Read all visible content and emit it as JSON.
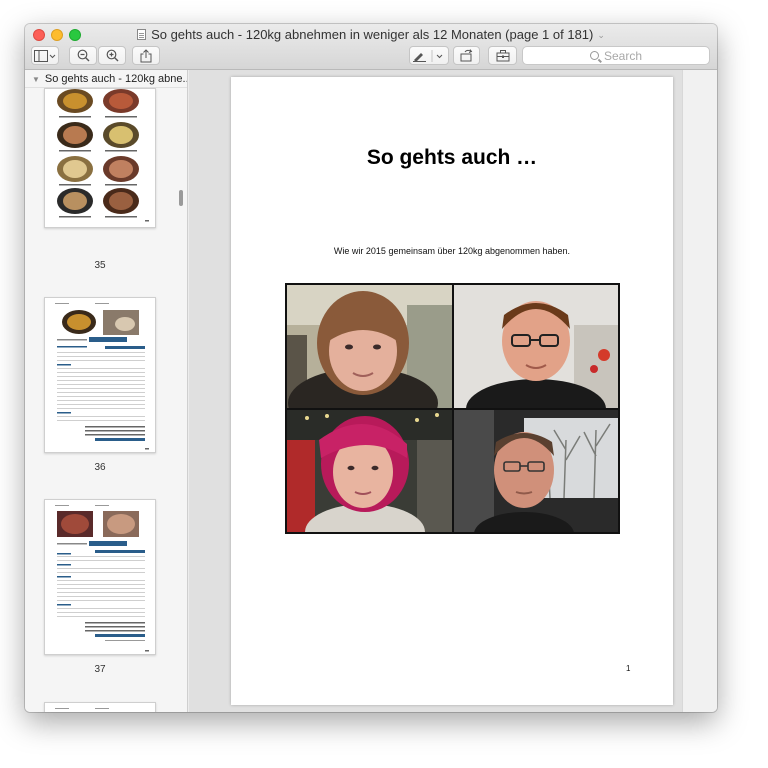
{
  "window": {
    "title": "So gehts auch - 120kg abnehmen in weniger als 12 Monaten (page 1 of 181)"
  },
  "toolbar": {
    "search_placeholder": "Search"
  },
  "sidebar": {
    "document_label": "So gehts auch - 120kg abne...",
    "thumbnails": [
      {
        "page": "35"
      },
      {
        "page": "36"
      },
      {
        "page": "37"
      }
    ]
  },
  "page": {
    "title": "So gehts auch …",
    "subtitle": "Wie wir 2015 gemeinsam über 120kg abgenommen haben.",
    "number": "1"
  },
  "colors": {
    "close": "#fc5f57",
    "minimize": "#fdbc2e",
    "maximize": "#29c840",
    "thumb_table_accent": "#2a5d8a"
  }
}
